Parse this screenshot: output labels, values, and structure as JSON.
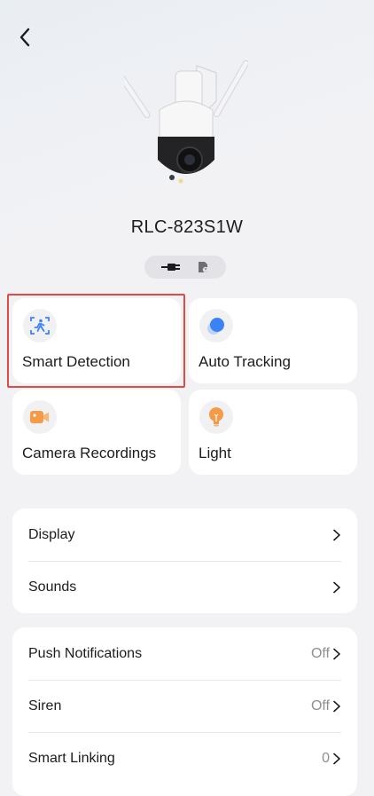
{
  "header": {
    "back_icon": "chevron-left-icon"
  },
  "device": {
    "name": "RLC-823S1W",
    "status_icons": [
      "plug-power-icon",
      "sd-card-icon"
    ]
  },
  "tiles": [
    {
      "label": "Smart Detection",
      "icon": "person-scan-icon",
      "color": "#3b82f6",
      "selected": true
    },
    {
      "label": "Auto Tracking",
      "icon": "tracking-dot-icon",
      "color": "#3b82f6"
    },
    {
      "label": "Camera Recordings",
      "icon": "video-camera-icon",
      "color": "#f59b47"
    },
    {
      "label": "Light",
      "icon": "lightbulb-icon",
      "color": "#f59b47"
    }
  ],
  "settings_group_1": [
    {
      "label": "Display",
      "value": ""
    },
    {
      "label": "Sounds",
      "value": ""
    }
  ],
  "settings_group_2": [
    {
      "label": "Push Notifications",
      "value": "Off"
    },
    {
      "label": "Siren",
      "value": "Off"
    },
    {
      "label": "Smart Linking",
      "value": "0"
    }
  ],
  "colors": {
    "highlight": "#e04b45",
    "background": "#f2f2f5"
  }
}
